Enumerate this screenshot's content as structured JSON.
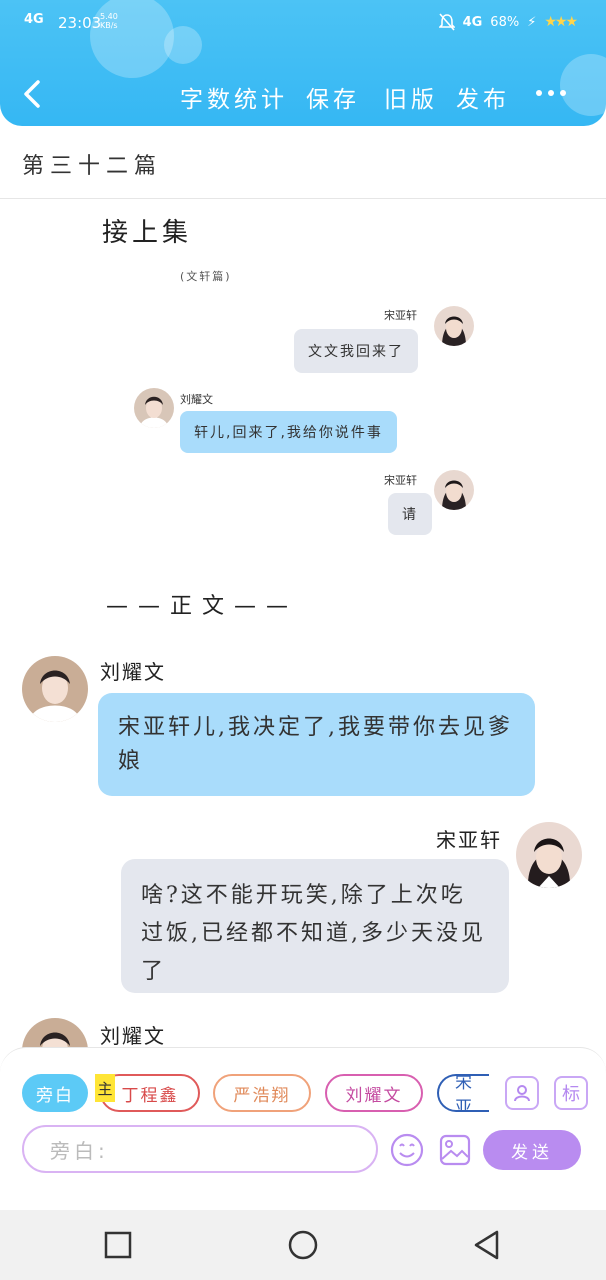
{
  "status_bar": {
    "signal_left": "4G",
    "time": "23:03",
    "speed": "5.40",
    "speed_unit": "KB/s",
    "signal_right": "4G",
    "battery": "68%"
  },
  "toolbar": {
    "word_count": "字数统计",
    "save": "保存",
    "old_version": "旧版",
    "publish": "发布"
  },
  "chapter_title": "第三十二篇",
  "recap": {
    "title": "接上集",
    "note": "(文轩篇)",
    "messages": [
      {
        "sender": "宋亚轩",
        "text": "文文我回来了",
        "side": "right"
      },
      {
        "sender": "刘耀文",
        "text": "轩儿,回来了,我给你说件事",
        "side": "left"
      },
      {
        "sender": "宋亚轩",
        "text": "请",
        "side": "right"
      }
    ]
  },
  "separator": "——正文——",
  "chat": {
    "messages": [
      {
        "sender": "刘耀文",
        "text": "宋亚轩儿,我决定了,我要带你去见爹娘",
        "side": "left"
      },
      {
        "sender": "宋亚轩",
        "text": "啥?这不能开玩笑,除了上次吃过饭,已经都不知道,多少天没见了",
        "side": "right"
      },
      {
        "sender": "刘耀文",
        "text": "",
        "side": "left"
      }
    ]
  },
  "role_chips": {
    "narrator": "旁白",
    "main_marker": "主",
    "roles": [
      "丁程鑫",
      "严浩翔",
      "刘耀文",
      "宋亚"
    ]
  },
  "role_buttons": {
    "add_role": "person-icon",
    "tag": "标"
  },
  "input": {
    "placeholder": "旁白:",
    "send_label": "发送"
  },
  "colors": {
    "header": "#35b7f3",
    "bubble_left": "#a9dcfb",
    "bubble_right": "#e4e7ee",
    "accent": "#b98cf0"
  }
}
